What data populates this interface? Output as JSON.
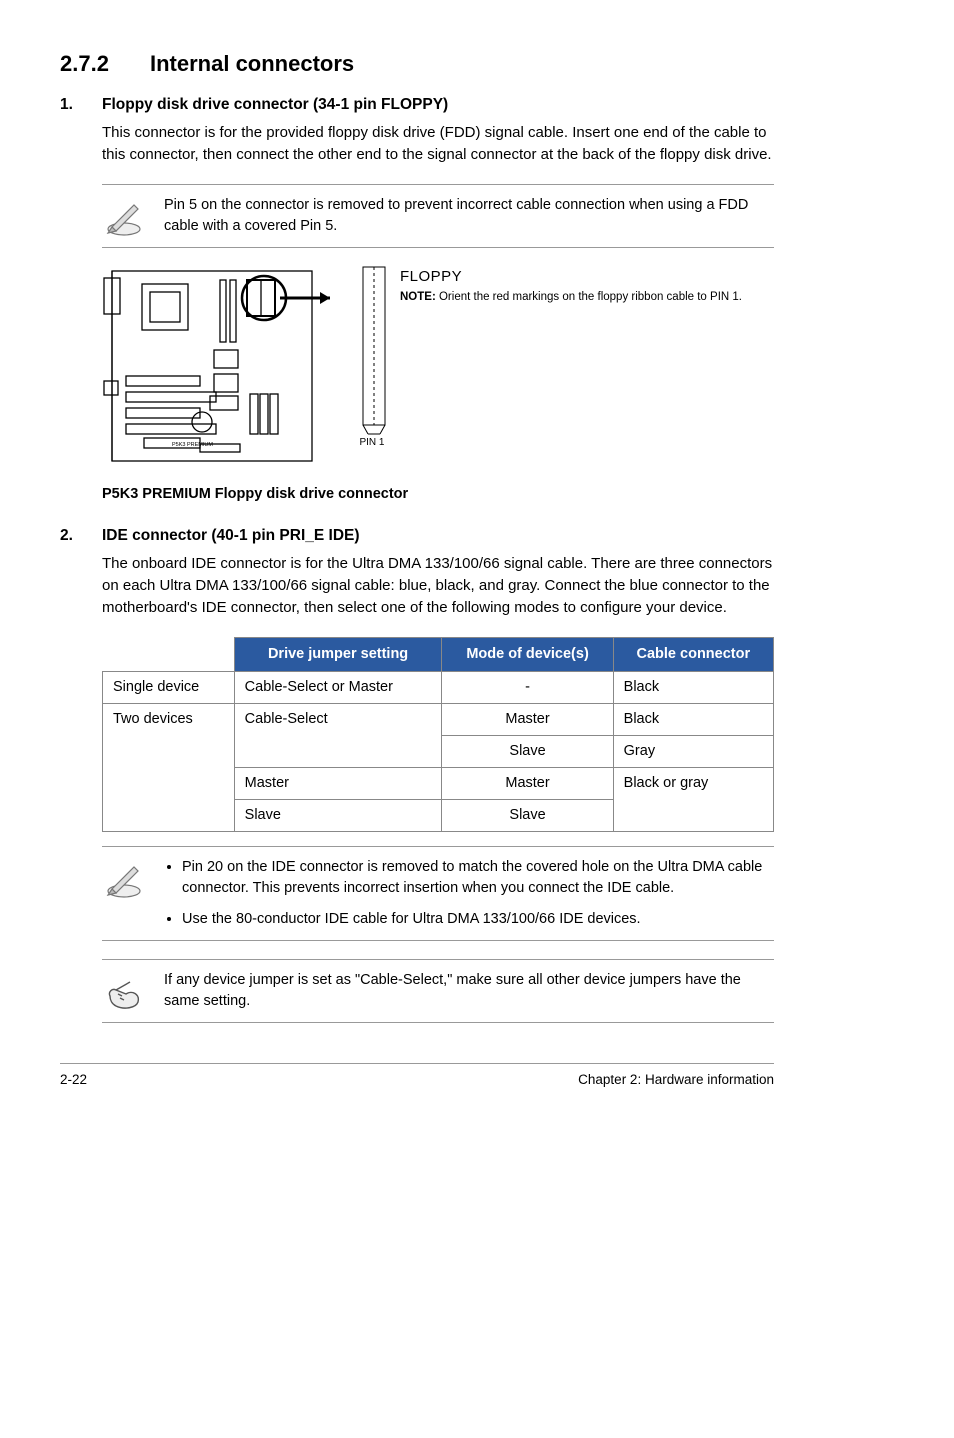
{
  "section": {
    "number": "2.7.2",
    "title": "Internal connectors"
  },
  "item1": {
    "num": "1.",
    "title": "Floppy disk drive connector (34-1 pin FLOPPY)",
    "body": "This connector is for the provided floppy disk drive (FDD) signal cable. Insert one end of the cable to this connector, then connect the other end to the signal connector at the back of the floppy disk drive.",
    "note": "Pin 5 on the connector is removed to prevent incorrect cable connection when using a FDD cable with a covered Pin 5."
  },
  "figure": {
    "conn_title": "FLOPPY",
    "conn_note_label": "NOTE:",
    "conn_note_text": "Orient the red markings on the floppy ribbon cable to PIN 1.",
    "pin1": "PIN 1",
    "board_label": "P5K3 PREMIUM",
    "caption": "P5K3 PREMIUM Floppy disk drive connector"
  },
  "item2": {
    "num": "2.",
    "title": "IDE connector (40-1 pin PRI_E IDE)",
    "body": "The onboard IDE connector is for the Ultra DMA 133/100/66 signal cable. There are three connectors on each Ultra DMA 133/100/66 signal cable: blue, black, and gray. Connect the blue connector to the motherboard's IDE connector, then select one of the following modes to configure your device."
  },
  "table": {
    "headers": [
      "",
      "Drive jumper setting",
      "Mode of device(s)",
      "Cable connector"
    ],
    "r1": {
      "c1": "Single device",
      "c2": "Cable-Select or Master",
      "c3": "-",
      "c4": "Black"
    },
    "r2": {
      "c1": "Two devices",
      "c2": "Cable-Select",
      "c3": "Master",
      "c4": "Black"
    },
    "r3": {
      "c3": "Slave",
      "c4": "Gray"
    },
    "r4": {
      "c2": "Master",
      "c3": "Master",
      "c4": "Black or gray"
    },
    "r5": {
      "c2": "Slave",
      "c3": "Slave"
    }
  },
  "note2": {
    "b1": "Pin 20 on the IDE connector is removed to match the covered hole on the Ultra DMA cable connector. This prevents incorrect insertion when you connect the IDE cable.",
    "b2": "Use the 80-conductor IDE cable for Ultra DMA 133/100/66 IDE devices."
  },
  "note3": "If any device jumper is set as \"Cable-Select,\" make sure all other device jumpers have the same setting.",
  "footer": {
    "left": "2-22",
    "right": "Chapter 2: Hardware information"
  }
}
